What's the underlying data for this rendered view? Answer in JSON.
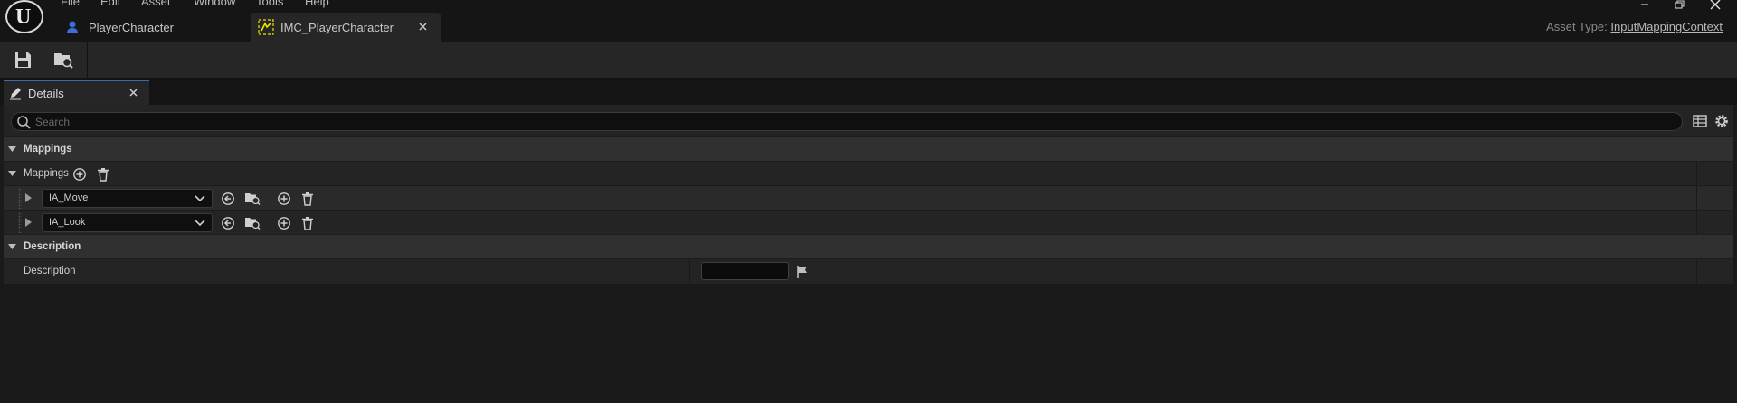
{
  "menu": [
    "File",
    "Edit",
    "Asset",
    "Window",
    "Tools",
    "Help"
  ],
  "tabs": [
    {
      "label": "PlayerCharacter",
      "active": false
    },
    {
      "label": "IMC_PlayerCharacter",
      "active": true
    }
  ],
  "asset_type": {
    "label": "Asset Type:",
    "value": "InputMappingContext"
  },
  "details_tab": {
    "label": "Details"
  },
  "search": {
    "placeholder": "Search"
  },
  "sections": {
    "mappings_category": "Mappings",
    "mappings_array_label": "Mappings",
    "description_category": "Description",
    "description_label": "Description",
    "description_value": ""
  },
  "mappings": [
    {
      "action": "IA_Move"
    },
    {
      "action": "IA_Look"
    }
  ],
  "colors": {
    "accent": "#3a6ea5",
    "background": "#1a1a1a",
    "panel": "#242424",
    "category_row": "#303030",
    "imc_tab_icon": "#e6e600"
  },
  "icons": [
    "unreal-logo-icon",
    "minimize-icon",
    "restore-icon",
    "close-icon",
    "blueprint-icon",
    "input-mapping-icon",
    "save-icon",
    "browse-icon",
    "pencil-icon",
    "search-icon",
    "table-view-icon",
    "gear-icon",
    "chevron-down-icon",
    "chevron-right-icon",
    "add-icon",
    "delete-icon",
    "reset-arrow-icon",
    "flag-icon"
  ]
}
